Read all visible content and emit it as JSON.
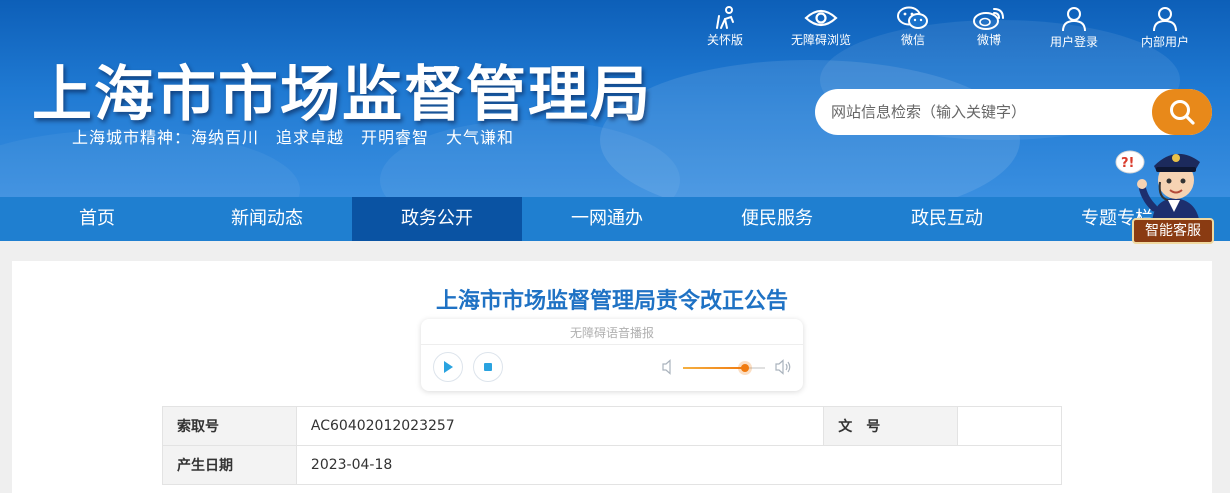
{
  "header": {
    "title": "上海市市场监督管理局",
    "motto": "上海城市精神：海纳百川　追求卓越　开明睿智　大气谦和"
  },
  "tools": [
    {
      "label": "关怀版",
      "icon": "care-icon"
    },
    {
      "label": "无障碍浏览",
      "icon": "eye-icon"
    },
    {
      "label": "微信",
      "icon": "wechat-icon"
    },
    {
      "label": "微博",
      "icon": "weibo-icon"
    },
    {
      "label": "用户登录",
      "icon": "user-icon"
    },
    {
      "label": "内部用户",
      "icon": "user-icon"
    }
  ],
  "search": {
    "placeholder": "网站信息检索（输入关键字）"
  },
  "nav": {
    "items": [
      {
        "label": "首页"
      },
      {
        "label": "新闻动态"
      },
      {
        "label": "政务公开",
        "active": true
      },
      {
        "label": "一网通办"
      },
      {
        "label": "便民服务"
      },
      {
        "label": "政民互动"
      },
      {
        "label": "专题专栏"
      }
    ],
    "active_color": "#0a53a3",
    "bar_color": "#1f7fd0"
  },
  "service": {
    "label": "智能客服",
    "bubble": "?!"
  },
  "article": {
    "title": "上海市市场监督管理局责令改正公告",
    "title_color": "#1f72c4"
  },
  "player": {
    "label": "无障碍语音播报",
    "volume": 0.76,
    "accent": "#f07b10"
  },
  "meta": {
    "rows": [
      {
        "k1": "索取号",
        "v1": "AC60402012023257",
        "k2": "文　号",
        "v2": ""
      },
      {
        "k1": "产生日期",
        "v1": "2023-04-18"
      }
    ]
  }
}
